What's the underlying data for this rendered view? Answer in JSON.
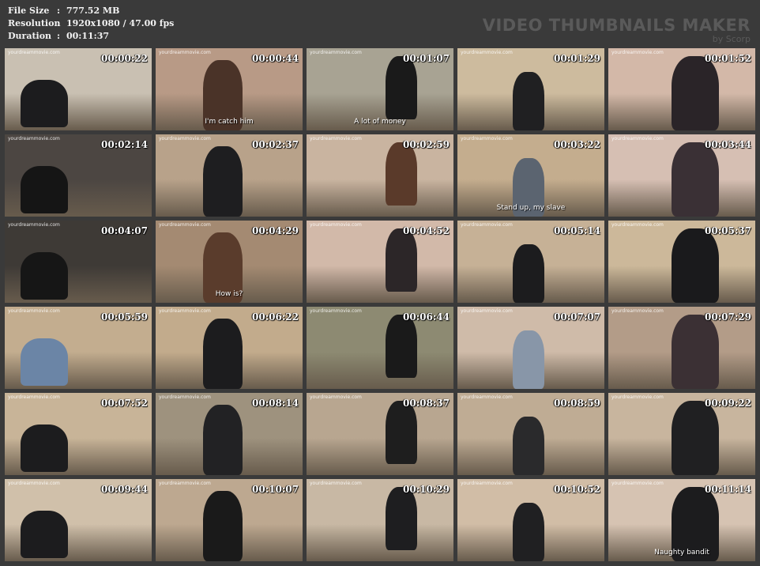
{
  "info": {
    "file_size_label": "File Size",
    "file_size_value": "777.52 MB",
    "resolution_label": "Resolution",
    "resolution_value": "1920x1080 / 47.00 fps",
    "duration_label": "Duration",
    "duration_value": "00:11:37",
    "separator": ":"
  },
  "brand": {
    "title": "VIDEO THUMBNAILS MAKER",
    "subtitle": "by Scorp"
  },
  "watermark": "yourdreammovie.com",
  "thumbnails": [
    {
      "time": "00:00:22",
      "subtitle": "",
      "bg": "#c9c0b2",
      "fig": "#1c1c1e"
    },
    {
      "time": "00:00:44",
      "subtitle": "I'm catch him",
      "bg": "#b89a86",
      "fig": "#4a3328"
    },
    {
      "time": "00:01:07",
      "subtitle": "A lot of money",
      "bg": "#a8a393",
      "fig": "#1a1a1a"
    },
    {
      "time": "00:01:29",
      "subtitle": "",
      "bg": "#cdbb9e",
      "fig": "#202022"
    },
    {
      "time": "00:01:52",
      "subtitle": "",
      "bg": "#d3b8a8",
      "fig": "#2a2428"
    },
    {
      "time": "00:02:14",
      "subtitle": "",
      "bg": "#4c4642",
      "fig": "#151515"
    },
    {
      "time": "00:02:37",
      "subtitle": "",
      "bg": "#b8a28a",
      "fig": "#1e1e20"
    },
    {
      "time": "00:02:59",
      "subtitle": "",
      "bg": "#c9b4a0",
      "fig": "#5a3a2a"
    },
    {
      "time": "00:03:22",
      "subtitle": "Stand up, my slave",
      "bg": "#c4ad8e",
      "fig": "#5b6470"
    },
    {
      "time": "00:03:44",
      "subtitle": "",
      "bg": "#d6bfb3",
      "fig": "#3a3035"
    },
    {
      "time": "00:04:07",
      "subtitle": "",
      "bg": "#3e3a36",
      "fig": "#161616"
    },
    {
      "time": "00:04:29",
      "subtitle": "How is?",
      "bg": "#a48a72",
      "fig": "#5a3c2c"
    },
    {
      "time": "00:04:52",
      "subtitle": "",
      "bg": "#d2b9a9",
      "fig": "#2c2628"
    },
    {
      "time": "00:05:14",
      "subtitle": "",
      "bg": "#c6b196",
      "fig": "#1c1c1e"
    },
    {
      "time": "00:05:37",
      "subtitle": "",
      "bg": "#ccb89a",
      "fig": "#1a1a1c"
    },
    {
      "time": "00:05:59",
      "subtitle": "",
      "bg": "#c3ad8f",
      "fig": "#6b85a6"
    },
    {
      "time": "00:06:22",
      "subtitle": "",
      "bg": "#c2ab8c",
      "fig": "#1c1c1e"
    },
    {
      "time": "00:06:44",
      "subtitle": "",
      "bg": "#8d8a72",
      "fig": "#1a1a1a"
    },
    {
      "time": "00:07:07",
      "subtitle": "",
      "bg": "#cfbba9",
      "fig": "#8896a8"
    },
    {
      "time": "00:07:29",
      "subtitle": "",
      "bg": "#b39c88",
      "fig": "#3b3034"
    },
    {
      "time": "00:07:52",
      "subtitle": "",
      "bg": "#c8b498",
      "fig": "#1c1c1e"
    },
    {
      "time": "00:08:14",
      "subtitle": "",
      "bg": "#9e927e",
      "fig": "#222224"
    },
    {
      "time": "00:08:37",
      "subtitle": "",
      "bg": "#b8a690",
      "fig": "#1e1e1e"
    },
    {
      "time": "00:08:59",
      "subtitle": "",
      "bg": "#bfac94",
      "fig": "#2a2a2c"
    },
    {
      "time": "00:09:22",
      "subtitle": "",
      "bg": "#c8b59e",
      "fig": "#202022"
    },
    {
      "time": "00:09:44",
      "subtitle": "",
      "bg": "#d0c0aa",
      "fig": "#1c1c1e"
    },
    {
      "time": "00:10:07",
      "subtitle": "",
      "bg": "#bda890",
      "fig": "#1a1a1a"
    },
    {
      "time": "00:10:29",
      "subtitle": "",
      "bg": "#c8b8a4",
      "fig": "#1e1e20"
    },
    {
      "time": "00:10:52",
      "subtitle": "",
      "bg": "#d1bda6",
      "fig": "#202022"
    },
    {
      "time": "00:11:14",
      "subtitle": "Naughty bandit",
      "bg": "#d6c3b2",
      "fig": "#1c1c1e"
    }
  ]
}
